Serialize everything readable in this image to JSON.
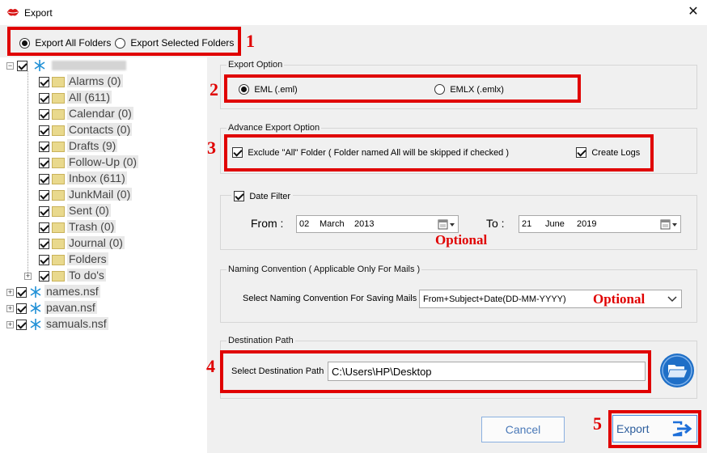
{
  "window": {
    "title": "Export",
    "close_glyph": "✕"
  },
  "scope": {
    "options": [
      "Export All Folders",
      "Export Selected Folders"
    ],
    "selected": "Export All Folders"
  },
  "tree": {
    "items": [
      {
        "label": "Alarms (0)"
      },
      {
        "label": "All (611)"
      },
      {
        "label": "Calendar (0)"
      },
      {
        "label": "Contacts (0)"
      },
      {
        "label": "Drafts (9)"
      },
      {
        "label": "Follow-Up (0)"
      },
      {
        "label": "Inbox (611)"
      },
      {
        "label": "JunkMail (0)"
      },
      {
        "label": "Sent (0)"
      },
      {
        "label": "Trash (0)"
      },
      {
        "label": "Journal (0)"
      },
      {
        "label": "Folders"
      },
      {
        "label": "To do's"
      }
    ],
    "files": [
      {
        "label": "names.nsf"
      },
      {
        "label": "pavan.nsf"
      },
      {
        "label": "samuals.nsf"
      }
    ]
  },
  "export_option": {
    "title": "Export Option",
    "eml_label": "EML (.eml)",
    "emlx_label": "EMLX (.emlx)",
    "selected": "EML (.eml)"
  },
  "advance": {
    "title": "Advance Export Option",
    "exclude_label": "Exclude \"All\" Folder ( Folder named All will be skipped if checked )",
    "exclude_checked": true,
    "logs_label": "Create Logs",
    "logs_checked": true
  },
  "date_filter": {
    "title": "Date Filter",
    "checked": true,
    "from_label": "From :",
    "from_day": "02",
    "from_month": "March",
    "from_year": "2013",
    "to_label": "To :",
    "to_day": "21",
    "to_month": "June",
    "to_year": "2019"
  },
  "naming": {
    "title": "Naming Convention ( Applicable Only For Mails )",
    "label": "Select Naming Convention For Saving Mails",
    "value": "From+Subject+Date(DD-MM-YYYY)"
  },
  "destination": {
    "title": "Destination Path",
    "label": "Select Destination Path",
    "value": "C:\\Users\\HP\\Desktop"
  },
  "buttons": {
    "cancel": "Cancel",
    "export": "Export"
  },
  "annotations": {
    "n1": "1",
    "n2": "2",
    "n3": "3",
    "n4": "4",
    "n5": "5",
    "optional": "Optional"
  },
  "colors": {
    "annotation_red": "#e00000",
    "accent_blue": "#1e6fd9",
    "panel_gray": "#f0f0f0"
  },
  "icons": {
    "app": "lips-logo-icon",
    "close": "close-icon",
    "db": "snowflake-db-icon",
    "folder": "folder-icon",
    "calendar": "calendar-icon",
    "browse": "open-folder-icon",
    "export": "export-arrow-icon"
  }
}
